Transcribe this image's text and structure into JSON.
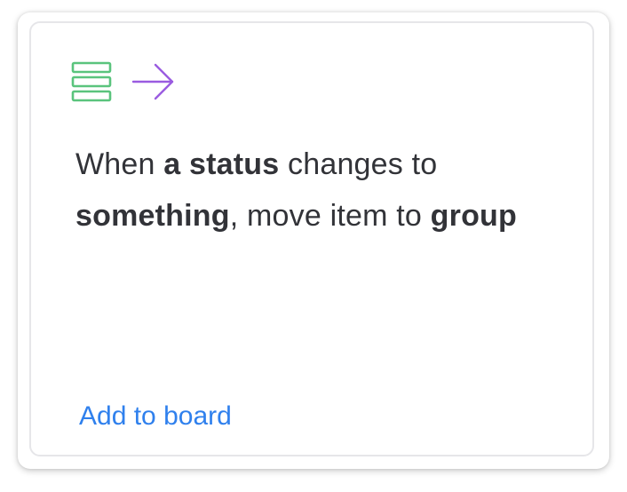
{
  "card": {
    "icons": {
      "trigger": "table-rows-icon",
      "action": "arrow-right-icon",
      "trigger_color": "#5ac47d",
      "action_color": "#9a5ce0"
    },
    "recipe": {
      "part1": "When ",
      "part2": "a status",
      "part3": " changes to ",
      "part4": "something",
      "part5": ", move item to ",
      "part6": "group"
    },
    "link_label": "Add to board",
    "link_color": "#2f80ed"
  }
}
